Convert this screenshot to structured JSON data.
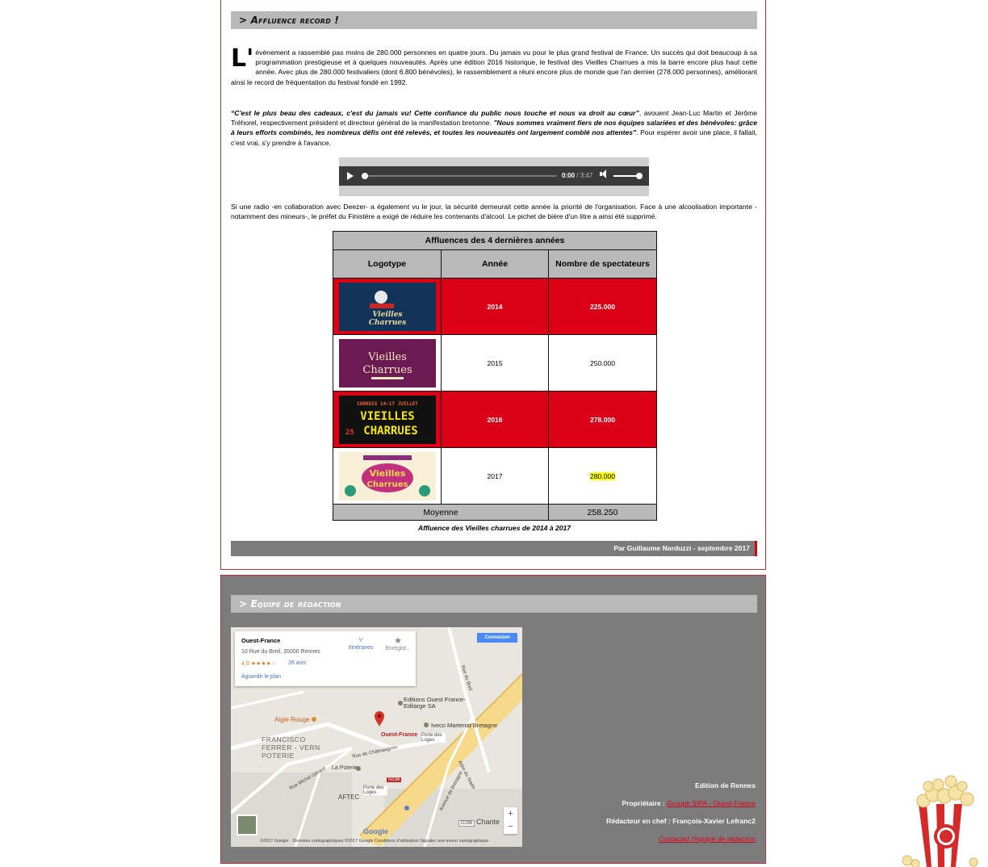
{
  "article": {
    "section_title": "> Affluence record !",
    "drop_cap": "L'",
    "p1": "événement a rassemblé pas moins de 280.000 personnes en quatre jours. Du jamais vu pour le plus grand festival de France. Un succès qui doit beaucoup à sa programmation prestigieuse et à quelques nouveautés. Après une édition 2016 historique, le festival des Vieilles Charrues a mis la barre encore plus haut cette année. Avec plus de 280.000 festivaliers (dont 6.800 bénévoles), le rassemblement a réuni encore plus de monde que l'an dernier (278.000 personnes), améliorant ainsi le record de fréquentation du festival fondé en 1992.",
    "p2_quote1": "“C'est le plus beau des cadeaux, c'est du jamais vu! Cette confiance du public nous touche et nous va droit au cœur”",
    "p2_mid": ", avouent Jean-Luc Martin et Jérôme Tréhorel, respectivement président et directeur général de la manifestation bretonne. ",
    "p2_quote2": "\"Nous sommes vraiment fiers de nos équipes salariées et des bénévoles: grâce à leurs efforts combinés, les nombreux défis ont été relevés, et toutes les nouveautés ont largement comblé nos attentes\"",
    "p2_end": ". Pour espérer avoir une place, il fallait, c'est vrai, s'y prendre à l'avance.",
    "p3": "Si une radio -en collaboration avec Deezer- a également vu le jour, la sécurité demeurait cette année la priorité de l'organisation. Face à une alcoolisation importante -notamment des mineurs-, le préfet du Finistère a exigé de réduire les contenants d'alcool. Le pichet de bière d'un litre a ainsi été supprimé.",
    "audio": {
      "current": "0:00",
      "duration": "/ 3:47",
      "progress": 0,
      "volume": 1.0
    },
    "table": {
      "caption": "Affluences des 4 dernières années",
      "headers": [
        "Logotype",
        "Année",
        "Nombre de spectateurs"
      ],
      "rows": [
        {
          "logo": "vieilles-charrues-2014-logo",
          "year": "2014",
          "spectators": "225.000"
        },
        {
          "logo": "vieilles-charrues-2015-logo",
          "year": "2015",
          "spectators": "250.000"
        },
        {
          "logo": "vieilles-charrues-2016-logo",
          "year": "2016",
          "spectators": "278.000"
        },
        {
          "logo": "vieilles-charrues-2017-logo",
          "year": "2017",
          "spectators": "280.000"
        }
      ],
      "average_label": "Moyenne",
      "average_value": "258.250"
    },
    "figure_caption": "Affluence des Vieilles charrues de 2014 à 2017",
    "author": "Par Guillaume Narduzzi - septembre 2017"
  },
  "team": {
    "section_title": "> Equipe de rédaction",
    "map": {
      "place_name": "Ouest-France",
      "address": "10 Rue du Breil, 35000 Rennes",
      "rating": "4,0",
      "stars": "★★★★☆",
      "reviews": "26 avis",
      "enlarge": "Agrandir le plan",
      "directions": "Itinéraires",
      "save": "Enregist...",
      "connexion": "Connexion",
      "labels": {
        "editions": "Editions Ouest France-Edilarge SA",
        "iveco": "Iveco Martenat Bretagne",
        "marker": "Ouest-France",
        "aigle": "Aigle Rouge",
        "francisco": "FRANCISCO FERRER - VERN POTERIE",
        "poterie": "La Poterie",
        "aftec": "AFTEC",
        "porte1": "Porte des Loges",
        "porte2": "Porte des Loges",
        "rue_chateaugiron": "Rue de Châteaugiron",
        "rue_breil": "Rue du Breil",
        "allee_stade": "Allée du Stade",
        "av_bretagne": "Avenue de Bretagne",
        "rue_michel": "Rue Michel Gérard",
        "n136": "N136",
        "d286": "D286",
        "chantepie": "Chante"
      },
      "footer": "©2017 Google · Données cartographiques ©2017 Google    Conditions d'utilisation    Signaler une erreur cartographique",
      "google": "Google"
    },
    "edition": "Edition de Rennes",
    "owner_label": "Propriétaire : ",
    "owner_link": "Groupe SIPA - Ouest-France",
    "editor": "Rédacteur en chef : François-Xavier Lefranc2",
    "contact": "Contactez l'équipe de rédaction"
  },
  "colors": {
    "accent_red": "#dc0017",
    "header_grey": "#b9b9b9",
    "panel_grey": "#7b7b7b"
  }
}
